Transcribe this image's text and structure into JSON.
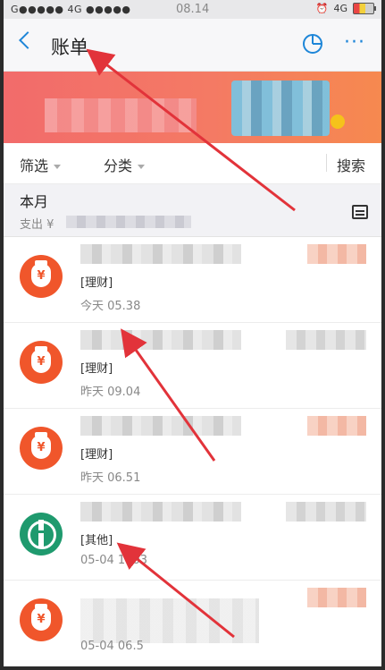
{
  "status_bar": {
    "signal": "G●●●●● 4G ●●●●●",
    "time": "08.14",
    "network": "4G"
  },
  "nav": {
    "title": "账单"
  },
  "filter": {
    "filter_label": "筛选",
    "category_label": "分类",
    "search_label": "搜索"
  },
  "month": {
    "label": "本月",
    "expense_prefix": "支出 ¥"
  },
  "transactions": [
    {
      "category": "[理财]",
      "time": "今天  05.38",
      "icon": "money-bag-icon"
    },
    {
      "category": "[理财]",
      "time": "昨天  09.04",
      "icon": "money-bag-icon"
    },
    {
      "category": "[理财]",
      "time": "昨天  06.51",
      "icon": "money-bag-icon"
    },
    {
      "category": "[其他]",
      "time": "05-04  1 .03",
      "icon": "bank-icon"
    },
    {
      "category": "",
      "time": "05-04  06.5",
      "icon": "money-bag-icon"
    }
  ],
  "colors": {
    "accent": "#1e86d8",
    "annotation_arrow": "#e2333a",
    "money_bag": "#f0562b",
    "bank": "#1f9a6e"
  }
}
